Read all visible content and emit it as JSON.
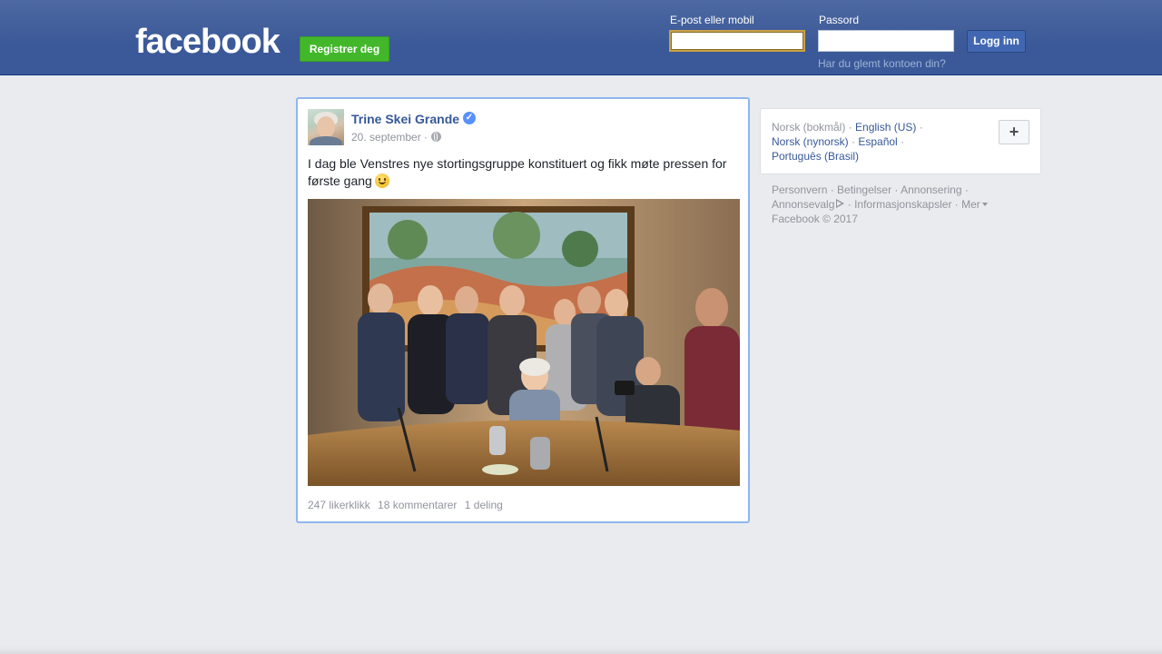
{
  "header": {
    "logo": "facebook",
    "register_label": "Registrer deg",
    "email_label": "E-post eller mobil",
    "email_value": "",
    "password_label": "Passord",
    "password_value": "",
    "login_label": "Logg inn",
    "forgot_label": "Har du glemt kontoen din?"
  },
  "post": {
    "author": "Trine Skei Grande",
    "verified_mark": "✓",
    "date": "20. september ·",
    "text": "I dag ble Venstres nye stortingsgruppe konstituert og fikk møte pressen for første gang",
    "stats": {
      "likes": "247 likerklikk",
      "comments": "18 kommentarer",
      "shares": "1 deling"
    }
  },
  "languages": {
    "current": "Norsk (bokmål)",
    "sep": " · ",
    "options": [
      "English (US)",
      "Norsk (nynorsk)",
      "Español",
      "Português (Brasil)"
    ],
    "more_symbol": "+"
  },
  "footer": {
    "links": [
      "Personvern",
      "Betingelser",
      "Annonsering",
      "Annonsevalg",
      "Informasjonskapsler",
      "Mer"
    ],
    "copyright": "Facebook © 2017"
  },
  "colors": {
    "brand_blue": "#3b5998",
    "register_green": "#42b72a",
    "link_blue": "#365899"
  }
}
